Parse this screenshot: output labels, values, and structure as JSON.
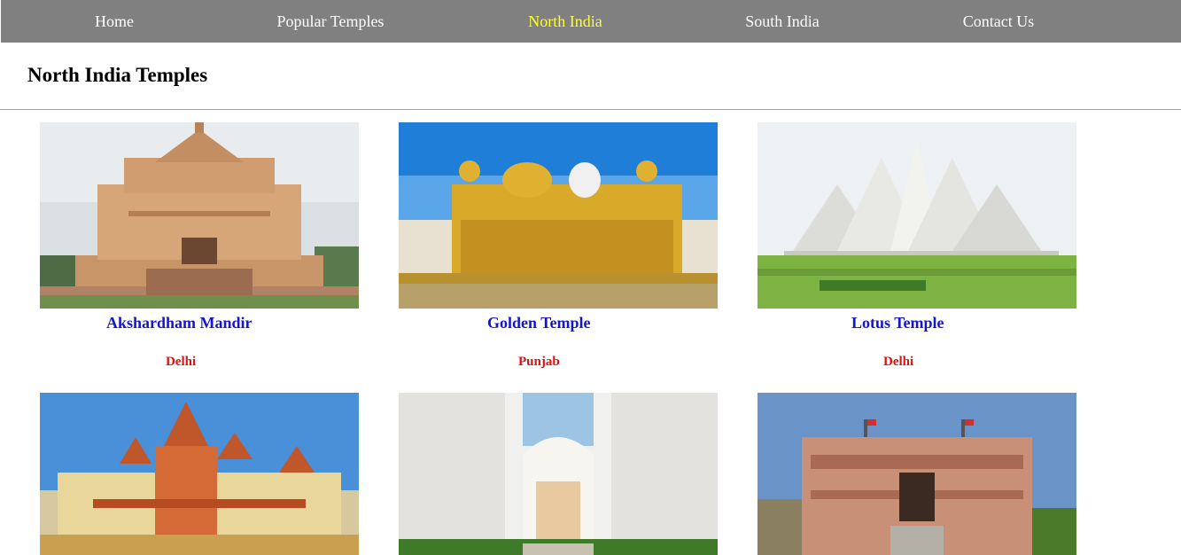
{
  "nav": {
    "items": [
      {
        "label": "Home",
        "active": false
      },
      {
        "label": "Popular Temples",
        "active": false
      },
      {
        "label": "North India",
        "active": true
      },
      {
        "label": "South India",
        "active": false
      },
      {
        "label": "Contact Us",
        "active": false
      }
    ]
  },
  "page": {
    "title": "North India Temples"
  },
  "temples": [
    {
      "name": "Akshardham Mandir",
      "location": "Delhi",
      "image_icon": "akshardham-temple-photo"
    },
    {
      "name": "Golden Temple",
      "location": "Punjab",
      "image_icon": "golden-temple-photo"
    },
    {
      "name": "Lotus Temple",
      "location": "Delhi",
      "image_icon": "lotus-temple-photo"
    },
    {
      "image_icon": "birla-mandir-photo"
    },
    {
      "image_icon": "iskcon-temple-photo"
    },
    {
      "image_icon": "rajasthan-temple-photo"
    }
  ],
  "colors": {
    "nav_bg": "#808080",
    "nav_text": "#ffffff",
    "nav_active": "#ffff33",
    "temple_name": "#1515cc",
    "temple_location": "#dd1111"
  }
}
